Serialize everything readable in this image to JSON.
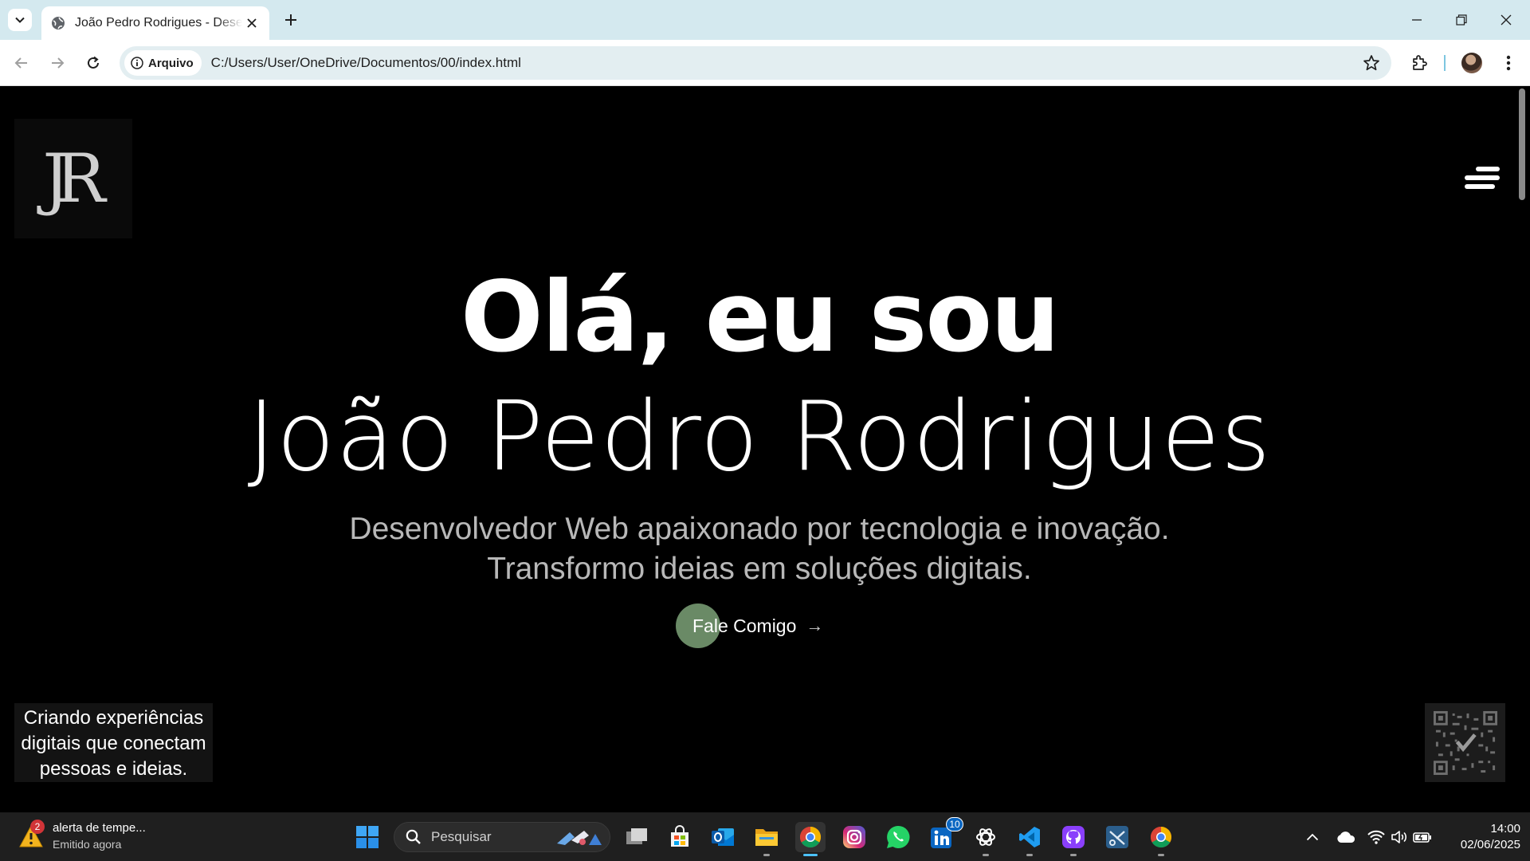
{
  "browser": {
    "tab_title": "João Pedro Rodrigues - Desenvolvedor Web",
    "site_chip_label": "Arquivo",
    "url": "C:/Users/User/OneDrive/Documentos/00/index.html"
  },
  "page": {
    "logo_text": "JR",
    "hero_greeting": "Olá, eu sou",
    "hero_name": "João Pedro Rodrigues",
    "hero_sub_line1": "Desenvolvedor Web apaixonado por tecnologia e inovação.",
    "hero_sub_line2": "Transformo ideias em soluções digitais.",
    "cta_label": "Fale Comigo",
    "cta_arrow": "→",
    "tagline": "Criando experiências digitais que conectam pessoas e ideias."
  },
  "taskbar": {
    "notification_title": "alerta de tempe...",
    "notification_sub": "Emitido agora",
    "notification_badge": "2",
    "search_placeholder": "Pesquisar",
    "linkedin_badge": "10",
    "time": "14:00",
    "date": "02/06/2025"
  },
  "colors": {
    "accent_green": "#6a8a66",
    "tabbar_bg": "#d4e9ef",
    "taskbar_bg": "#1f1f1f",
    "active_indicator": "#4cc2ff"
  },
  "icons": [
    "tab-search-icon",
    "globe-icon",
    "close-icon",
    "plus-icon",
    "minimize-icon",
    "restore-icon",
    "back-icon",
    "forward-icon",
    "reload-icon",
    "info-icon",
    "star-icon",
    "extensions-icon",
    "avatar",
    "menu-icon",
    "qr-code-icon",
    "weather-alert-icon",
    "windows-start-icon",
    "search-icon",
    "task-view-icon",
    "store-icon",
    "outlook-icon",
    "file-explorer-icon",
    "chrome-icon",
    "instagram-icon",
    "whatsapp-icon",
    "linkedin-icon",
    "chatgpt-icon",
    "vscode-icon",
    "github-icon",
    "chevron-up-icon",
    "onedrive-icon",
    "wifi-icon",
    "volume-icon",
    "battery-icon"
  ]
}
